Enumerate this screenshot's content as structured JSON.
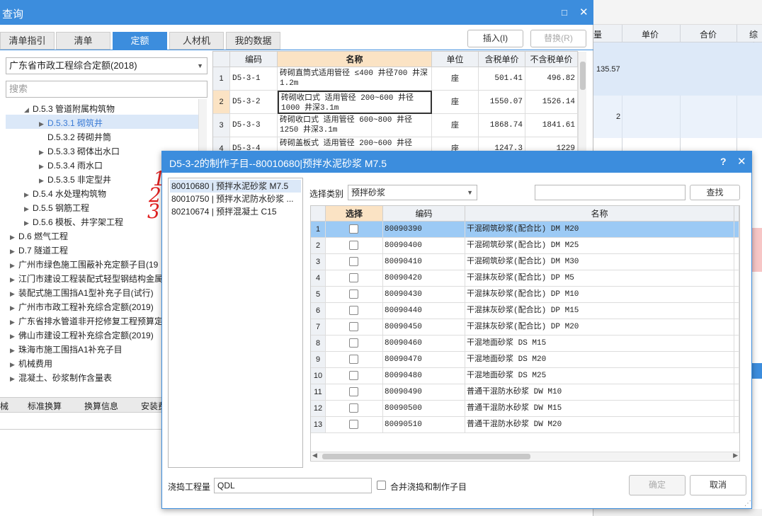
{
  "window": {
    "title": "查询"
  },
  "tabs": [
    {
      "label": "清单指引"
    },
    {
      "label": "清单"
    },
    {
      "label": "定额"
    },
    {
      "label": "人材机"
    },
    {
      "label": "我的数据"
    }
  ],
  "toolbar": {
    "insert_label": "插入(I)",
    "replace_label": "替换(R)"
  },
  "library": {
    "selected": "广东省市政工程综合定额(2018)",
    "search_placeholder": "搜索"
  },
  "tree": [
    {
      "label": "D.5.3 管道附属构筑物"
    },
    {
      "label": "D.5.3.1 砌筑井"
    },
    {
      "label": "D.5.3.2 砖砌井筒"
    },
    {
      "label": "D.5.3.3 砌体出水口"
    },
    {
      "label": "D.5.3.4 雨水口"
    },
    {
      "label": "D.5.3.5 非定型井"
    },
    {
      "label": "D.5.4 水处理构筑物"
    },
    {
      "label": "D.5.5 钢筋工程"
    },
    {
      "label": "D.5.6 模板、井字架工程"
    },
    {
      "label": "D.6 燃气工程"
    },
    {
      "label": "D.7 隧道工程"
    },
    {
      "label": "广州市绿色施工围蔽补充定额子目(19"
    },
    {
      "label": "江门市建设工程装配式轻型钢结构金属"
    },
    {
      "label": "装配式施工围挡A1型补充子目(试行)"
    },
    {
      "label": "广州市市政工程补充综合定额(2019)"
    },
    {
      "label": "广东省排水管道非开挖修复工程预算定"
    },
    {
      "label": "佛山市建设工程补充综合定额(2019)"
    },
    {
      "label": "珠海市施工围挡A1补充子目"
    },
    {
      "label": "机械费用"
    },
    {
      "label": "混凝土、砂浆制作含量表"
    }
  ],
  "bottom_tabs": [
    "械",
    "标准换算",
    "换算信息",
    "安装费"
  ],
  "quota_table": {
    "headers": [
      "编码",
      "名称",
      "单位",
      "含税单价",
      "不含税单价"
    ],
    "rows": [
      {
        "no": "1",
        "code": "D5-3-1",
        "name": "砖砌直筒式适用管径 ≤400 井径700 井深1.2m",
        "unit": "座",
        "price_tax": "501.41",
        "price_notax": "496.82"
      },
      {
        "no": "2",
        "code": "D5-3-2",
        "name": "砖砌收口式 适用管径 200~600 井径1000 井深3.1m",
        "unit": "座",
        "price_tax": "1550.07",
        "price_notax": "1526.14"
      },
      {
        "no": "3",
        "code": "D5-3-3",
        "name": "砖砌收口式 适用管径 600~800 井径1250 井深3.1m",
        "unit": "座",
        "price_tax": "1868.74",
        "price_notax": "1841.61"
      },
      {
        "no": "4",
        "code": "D5-3-4",
        "name": "砖砌盖板式 适用管径 200~600 井径",
        "unit": "座",
        "price_tax": "1247.3",
        "price_notax": "1229"
      }
    ]
  },
  "background": {
    "headers": [
      "量",
      "单价",
      "合价",
      "综合"
    ],
    "values": [
      "135.57",
      "2"
    ]
  },
  "dialog": {
    "title": "D5-3-2的制作子目--80010680|预拌水泥砂浆 M7.5",
    "items": [
      {
        "label": "80010680 | 预拌水泥砂浆 M7.5"
      },
      {
        "label": "80010750 | 预拌水泥防水砂浆 ..."
      },
      {
        "label": "80210674 | 预拌混凝土 C15"
      }
    ],
    "category_label": "选择类别",
    "category_value": "预拌砂浆",
    "search_value": "",
    "find_button": "查找",
    "headers": [
      "选择",
      "编码",
      "名称"
    ],
    "rows": [
      {
        "no": "1",
        "code": "80090390",
        "name": "干混砌筑砂浆(配合比) DM M20"
      },
      {
        "no": "2",
        "code": "80090400",
        "name": "干混砌筑砂浆(配合比) DM M25"
      },
      {
        "no": "3",
        "code": "80090410",
        "name": "干混砌筑砂浆(配合比) DM M30"
      },
      {
        "no": "4",
        "code": "80090420",
        "name": "干混抹灰砂浆(配合比) DP M5"
      },
      {
        "no": "5",
        "code": "80090430",
        "name": "干混抹灰砂浆(配合比) DP M10"
      },
      {
        "no": "6",
        "code": "80090440",
        "name": "干混抹灰砂浆(配合比) DP M15"
      },
      {
        "no": "7",
        "code": "80090450",
        "name": "干混抹灰砂浆(配合比) DP M20"
      },
      {
        "no": "8",
        "code": "80090460",
        "name": "干混地面砂浆 DS M15"
      },
      {
        "no": "9",
        "code": "80090470",
        "name": "干混地面砂浆 DS M20"
      },
      {
        "no": "10",
        "code": "80090480",
        "name": "干混地面砂浆 DS M25"
      },
      {
        "no": "11",
        "code": "80090490",
        "name": "普通干混防水砂浆 DW M10"
      },
      {
        "no": "12",
        "code": "80090500",
        "name": "普通干混防水砂浆 DW M15"
      },
      {
        "no": "13",
        "code": "80090510",
        "name": "普通干混防水砂浆 DW M20"
      }
    ],
    "pour_label": "浇捣工程量",
    "pour_value": "QDL",
    "merge_label": "合并浇捣和制作子目",
    "ok_label": "确定",
    "cancel_label": "取消"
  },
  "annotations": [
    "1",
    "2",
    "3"
  ],
  "colors": {
    "accent": "#3c8ddd",
    "selected_row": "#9ccaf5",
    "header_highlight": "#fbe3c4"
  }
}
